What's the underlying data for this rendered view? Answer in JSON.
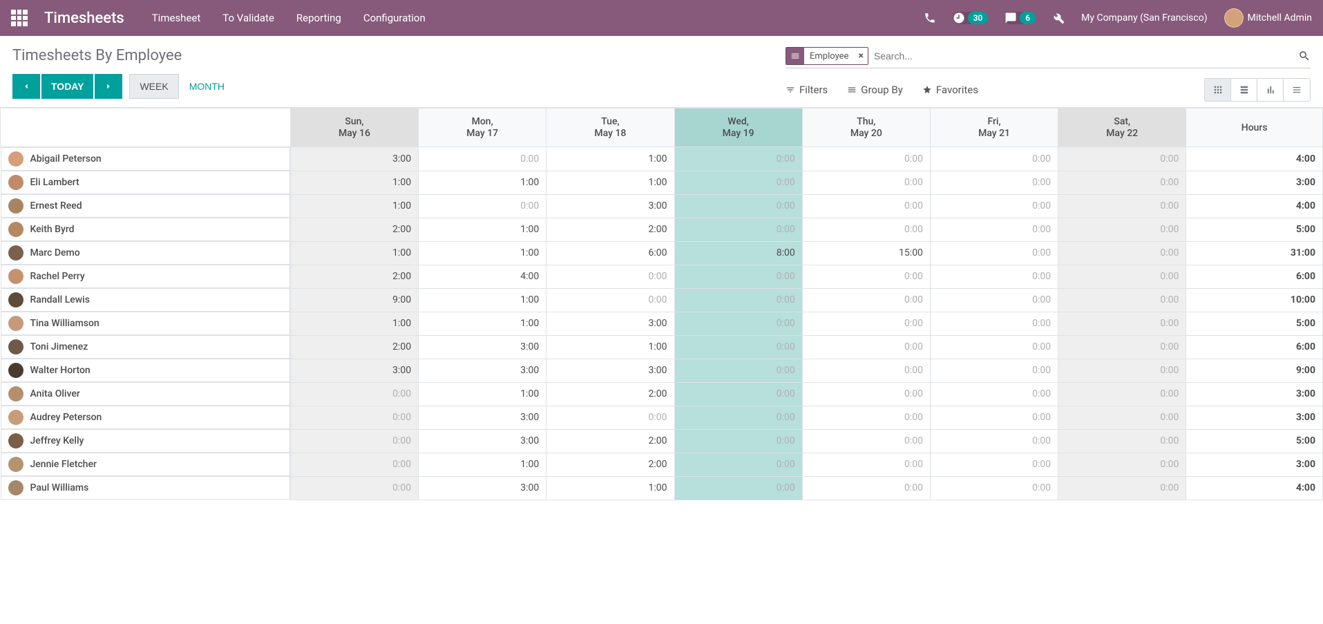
{
  "nav": {
    "brand": "Timesheets",
    "links": [
      "Timesheet",
      "To Validate",
      "Reporting",
      "Configuration"
    ],
    "timer_badge": "30",
    "msg_badge": "6",
    "company": "My Company (San Francisco)",
    "user": "Mitchell Admin"
  },
  "title": "Timesheets By Employee",
  "date_ctl": {
    "today": "TODAY",
    "scales": [
      "WEEK",
      "MONTH"
    ],
    "active_scale": 0
  },
  "search": {
    "facet_label": "Employee",
    "placeholder": "Search...",
    "opts": {
      "filters": "Filters",
      "group_by": "Group By",
      "favorites": "Favorites"
    }
  },
  "columns": {
    "row_head": "",
    "days": [
      {
        "dow": "Sun,",
        "date": "May 16",
        "kind": "weekend"
      },
      {
        "dow": "Mon,",
        "date": "May 17",
        "kind": "normal"
      },
      {
        "dow": "Tue,",
        "date": "May 18",
        "kind": "normal"
      },
      {
        "dow": "Wed,",
        "date": "May 19",
        "kind": "today"
      },
      {
        "dow": "Thu,",
        "date": "May 20",
        "kind": "normal"
      },
      {
        "dow": "Fri,",
        "date": "May 21",
        "kind": "normal"
      },
      {
        "dow": "Sat,",
        "date": "May 22",
        "kind": "weekend"
      }
    ],
    "total": "Hours"
  },
  "rows": [
    {
      "name": "Abigail Peterson",
      "cells": [
        "3:00",
        "0:00",
        "1:00",
        "0:00",
        "0:00",
        "0:00",
        "0:00"
      ],
      "total": "4:00",
      "avatar": "#d49f7a"
    },
    {
      "name": "Eli Lambert",
      "cells": [
        "1:00",
        "1:00",
        "1:00",
        "0:00",
        "0:00",
        "0:00",
        "0:00"
      ],
      "total": "3:00",
      "avatar": "#c28a6a"
    },
    {
      "name": "Ernest Reed",
      "cells": [
        "1:00",
        "0:00",
        "3:00",
        "0:00",
        "0:00",
        "0:00",
        "0:00"
      ],
      "total": "4:00",
      "avatar": "#a98463"
    },
    {
      "name": "Keith Byrd",
      "cells": [
        "2:00",
        "1:00",
        "2:00",
        "0:00",
        "0:00",
        "0:00",
        "0:00"
      ],
      "total": "5:00",
      "avatar": "#b58863"
    },
    {
      "name": "Marc Demo",
      "cells": [
        "1:00",
        "1:00",
        "6:00",
        "8:00",
        "15:00",
        "0:00",
        "0:00"
      ],
      "total": "31:00",
      "avatar": "#7a604d"
    },
    {
      "name": "Rachel Perry",
      "cells": [
        "2:00",
        "4:00",
        "0:00",
        "0:00",
        "0:00",
        "0:00",
        "0:00"
      ],
      "total": "6:00",
      "avatar": "#c6926d"
    },
    {
      "name": "Randall Lewis",
      "cells": [
        "9:00",
        "1:00",
        "0:00",
        "0:00",
        "0:00",
        "0:00",
        "0:00"
      ],
      "total": "10:00",
      "avatar": "#5f4b3a"
    },
    {
      "name": "Tina Williamson",
      "cells": [
        "1:00",
        "1:00",
        "3:00",
        "0:00",
        "0:00",
        "0:00",
        "0:00"
      ],
      "total": "5:00",
      "avatar": "#c69a7a"
    },
    {
      "name": "Toni Jimenez",
      "cells": [
        "2:00",
        "3:00",
        "1:00",
        "0:00",
        "0:00",
        "0:00",
        "0:00"
      ],
      "total": "6:00",
      "avatar": "#6d5a4a"
    },
    {
      "name": "Walter Horton",
      "cells": [
        "3:00",
        "3:00",
        "3:00",
        "0:00",
        "0:00",
        "0:00",
        "0:00"
      ],
      "total": "9:00",
      "avatar": "#4a3b2f"
    },
    {
      "name": "Anita Oliver",
      "cells": [
        "0:00",
        "1:00",
        "2:00",
        "0:00",
        "0:00",
        "0:00",
        "0:00"
      ],
      "total": "3:00",
      "avatar": "#b58e6d"
    },
    {
      "name": "Audrey Peterson",
      "cells": [
        "0:00",
        "3:00",
        "0:00",
        "0:00",
        "0:00",
        "0:00",
        "0:00"
      ],
      "total": "3:00",
      "avatar": "#c79c7a"
    },
    {
      "name": "Jeffrey Kelly",
      "cells": [
        "0:00",
        "3:00",
        "2:00",
        "0:00",
        "0:00",
        "0:00",
        "0:00"
      ],
      "total": "5:00",
      "avatar": "#7a5e48"
    },
    {
      "name": "Jennie Fletcher",
      "cells": [
        "0:00",
        "1:00",
        "2:00",
        "0:00",
        "0:00",
        "0:00",
        "0:00"
      ],
      "total": "3:00",
      "avatar": "#b6936f"
    },
    {
      "name": "Paul Williams",
      "cells": [
        "0:00",
        "3:00",
        "1:00",
        "0:00",
        "0:00",
        "0:00",
        "0:00"
      ],
      "total": "4:00",
      "avatar": "#a5876a"
    }
  ]
}
